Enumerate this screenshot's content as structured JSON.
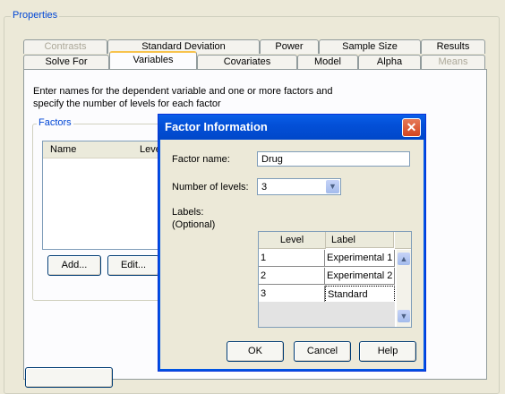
{
  "properties": {
    "group_title": "Properties"
  },
  "tabs_row1": [
    {
      "label": "Contrasts",
      "disabled": true
    },
    {
      "label": "Standard Deviation",
      "disabled": false
    },
    {
      "label": "Power",
      "disabled": false
    },
    {
      "label": "Sample Size",
      "disabled": false
    },
    {
      "label": "Results",
      "disabled": false
    }
  ],
  "tabs_row2": [
    {
      "label": "Solve For",
      "disabled": false
    },
    {
      "label": "Variables",
      "active": true
    },
    {
      "label": "Covariates",
      "disabled": false
    },
    {
      "label": "Model",
      "disabled": false
    },
    {
      "label": "Alpha",
      "disabled": false
    },
    {
      "label": "Means",
      "disabled": true
    }
  ],
  "panel": {
    "desc_line1": "Enter names for the dependent variable and one or more factors and",
    "desc_line2": "specify the number of levels for each factor",
    "factors_title": "Factors",
    "col_name": "Name",
    "col_levels": "Leve",
    "add_button": "Add...",
    "edit_button": "Edit..."
  },
  "dialog": {
    "title": "Factor Information",
    "factor_name_label": "Factor name:",
    "factor_name_value": "Drug",
    "levels_label": "Number of levels:",
    "levels_value": "3",
    "labels_label": "Labels:",
    "labels_optional": "(Optional)",
    "grid": {
      "headers": [
        "Level",
        "Label"
      ],
      "rows": [
        [
          "1",
          "Experimental 1"
        ],
        [
          "2",
          "Experimental 2"
        ],
        [
          "3",
          "Standard"
        ]
      ]
    },
    "ok": "OK",
    "cancel": "Cancel",
    "help": "Help",
    "colors": {
      "title_bar": "#0054e3",
      "close_button": "#d64520"
    }
  }
}
